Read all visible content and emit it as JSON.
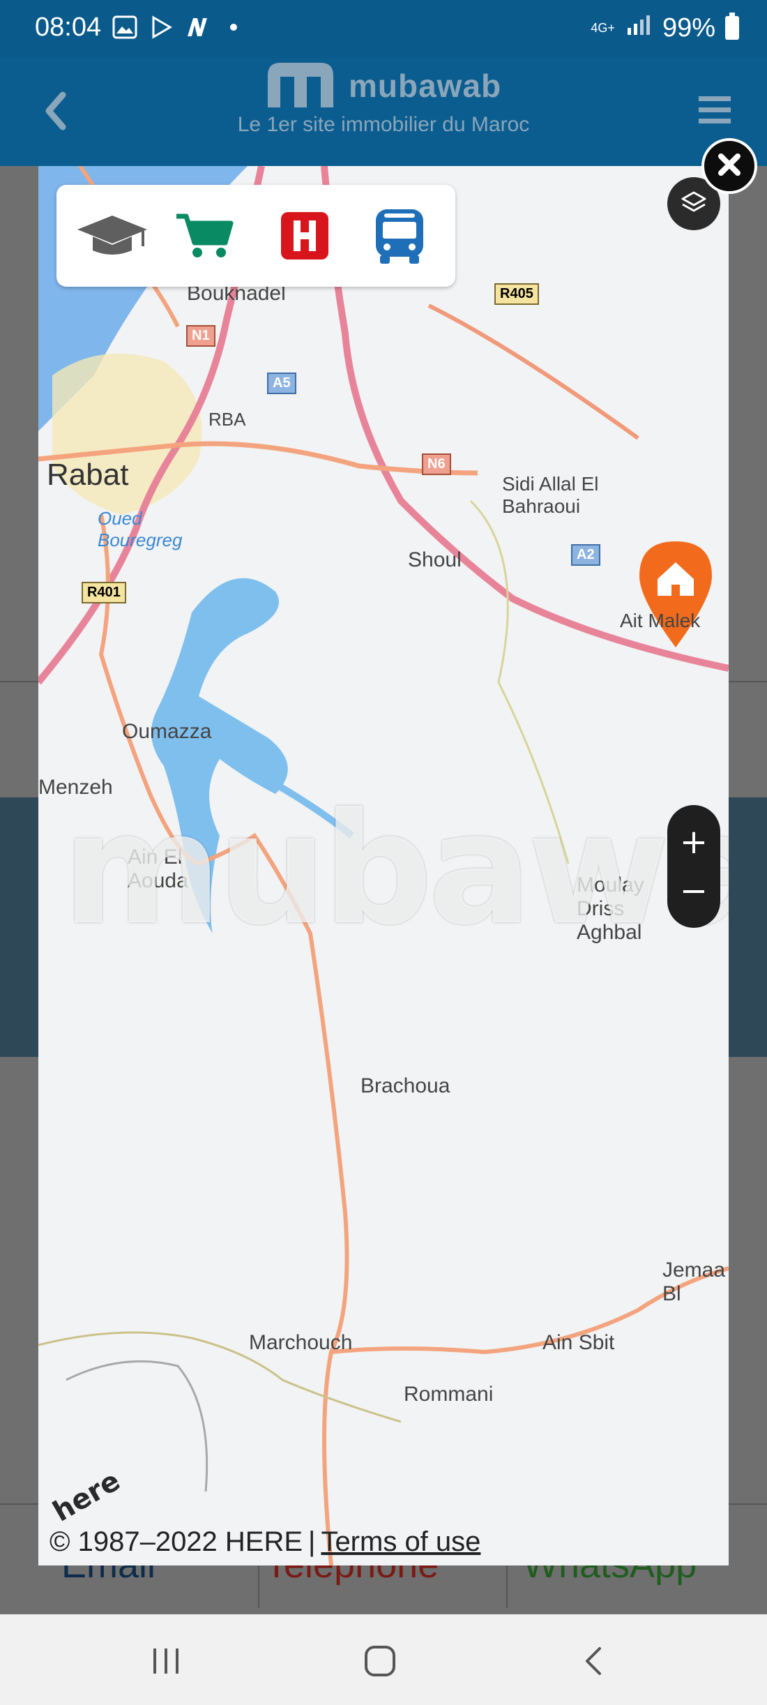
{
  "status_bar": {
    "time": "08:04",
    "network": "4G+",
    "battery": "99%",
    "icons": [
      "gallery-icon",
      "play-store-icon",
      "n-app-icon",
      "dot-icon",
      "signal-icon",
      "battery-icon"
    ]
  },
  "header": {
    "brand": "mubawab",
    "tagline": "Le 1er site immobilier du Maroc",
    "colors": {
      "background": "#0c5d8f",
      "brand_text": "#8aa6bb"
    }
  },
  "map": {
    "poi_filters": [
      {
        "icon": "education-icon",
        "color": "#5f5f5f"
      },
      {
        "icon": "shopping-cart-icon",
        "color": "#0a8a62"
      },
      {
        "icon": "hospital-icon",
        "color": "#d8151c"
      },
      {
        "icon": "bus-icon",
        "color": "#1e6fb8"
      }
    ],
    "places": [
      "Bouknadel",
      "RBA",
      "Rabat",
      "Oued Bouregreg",
      "Sidi Allal El Bahraoui",
      "Shoul",
      "Ait Malek",
      "Oumazza",
      "Menzeh",
      "Ain El Aouda",
      "Moulay Driss Aghbal",
      "Brachoua",
      "Jemaa Bl",
      "Marchouch",
      "Ain Sbit",
      "Rommani"
    ],
    "road_labels": [
      "R405",
      "N1",
      "A5",
      "N6",
      "A2",
      "R401"
    ],
    "watermark": "mubawab",
    "zoom_in": "+",
    "zoom_out": "−",
    "here_logo": "here",
    "copyright": "© 1987–2022 HERE",
    "separator": "|",
    "terms": "Terms of use",
    "marker_color": "#f26b1d"
  },
  "background_page": {
    "actions": [
      "Email",
      "Telephone",
      "WhatsApp"
    ]
  }
}
